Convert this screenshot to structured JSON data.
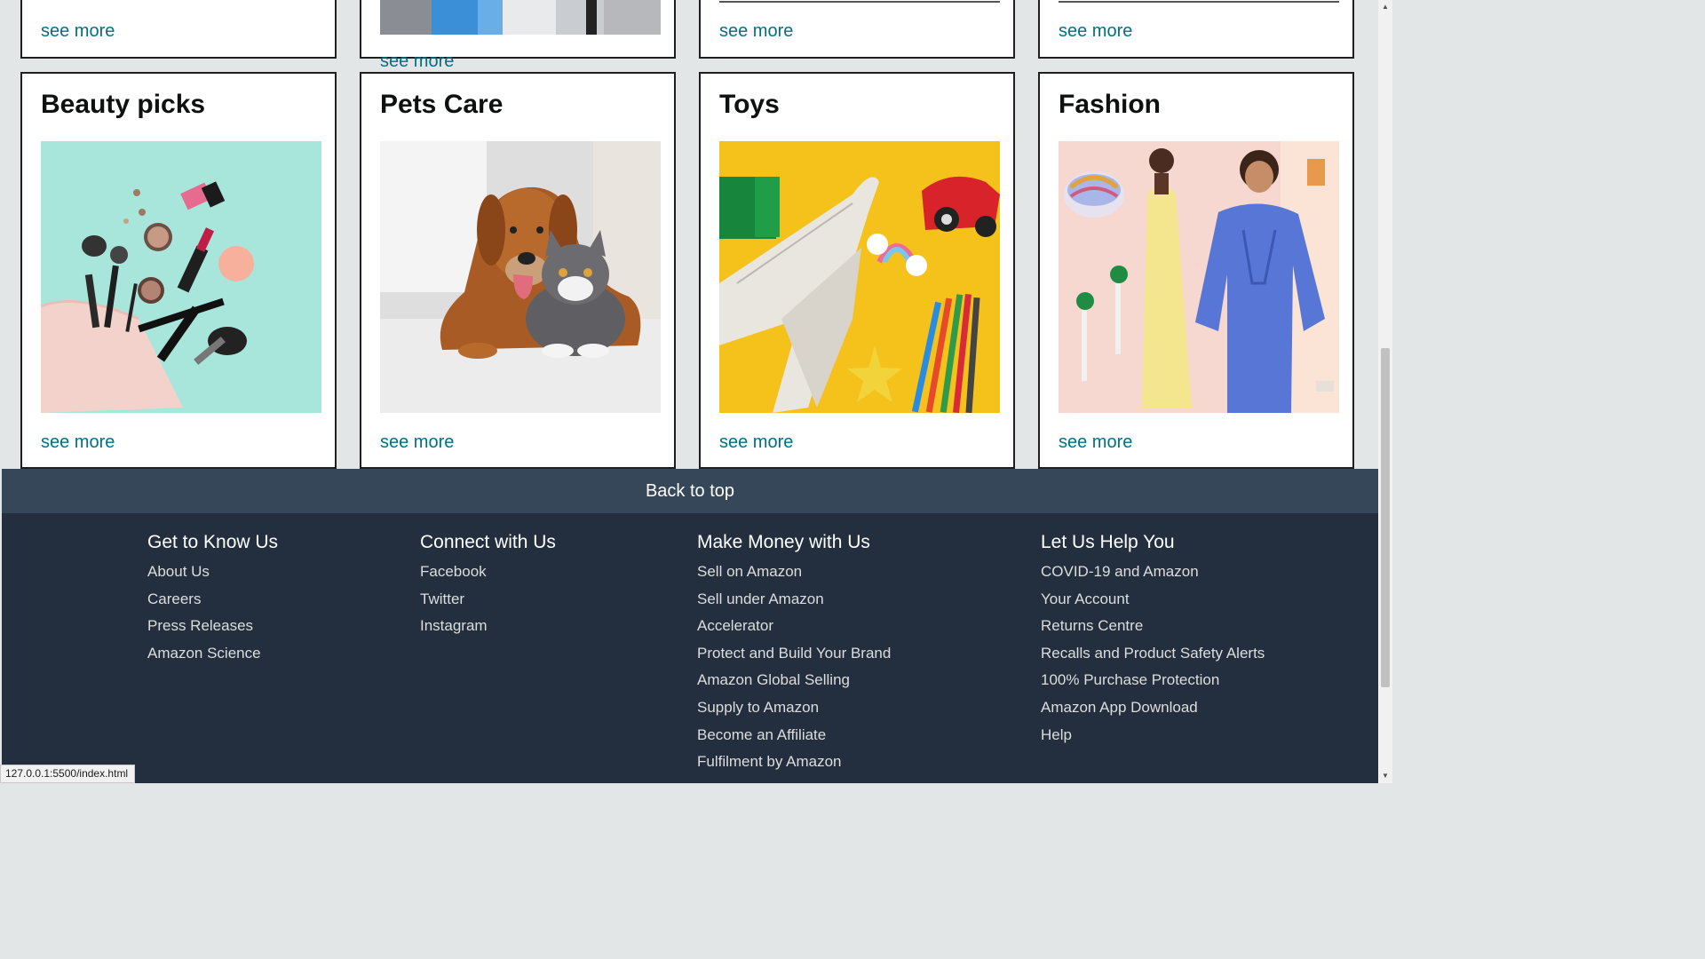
{
  "top_row": {
    "see_more": [
      "see more",
      "see more",
      "see more",
      "see more"
    ]
  },
  "cards": [
    {
      "title": "Beauty picks",
      "see_more": "see more"
    },
    {
      "title": "Pets Care",
      "see_more": "see more"
    },
    {
      "title": "Toys",
      "see_more": "see more"
    },
    {
      "title": "Fashion",
      "see_more": "see more"
    }
  ],
  "footer": {
    "back_to_top": "Back to top",
    "columns": [
      {
        "title": "Get to Know Us",
        "links": [
          "About Us",
          "Careers",
          "Press Releases",
          "Amazon Science"
        ]
      },
      {
        "title": "Connect with Us",
        "links": [
          "Facebook",
          "Twitter",
          "Instagram"
        ]
      },
      {
        "title": "Make Money with Us",
        "links": [
          "Sell on Amazon",
          "Sell under Amazon",
          "Accelerator",
          "Protect and Build Your Brand",
          "Amazon Global Selling",
          "Supply to Amazon",
          "Become an Affiliate",
          "Fulfilment by Amazon"
        ]
      },
      {
        "title": "Let Us Help You",
        "links": [
          "COVID-19 and Amazon",
          "Your Account",
          "Returns Centre",
          "Recalls and Product Safety Alerts",
          "100% Purchase Protection",
          "Amazon App Download",
          "Help"
        ]
      }
    ]
  },
  "status_bar": {
    "url": "127.0.0.1:5500/index.html"
  },
  "colors": {
    "page_bg": "#e3e6e6",
    "link": "#007185",
    "back_to_top_bg": "#37475a",
    "footer_bg": "#232f3e"
  }
}
